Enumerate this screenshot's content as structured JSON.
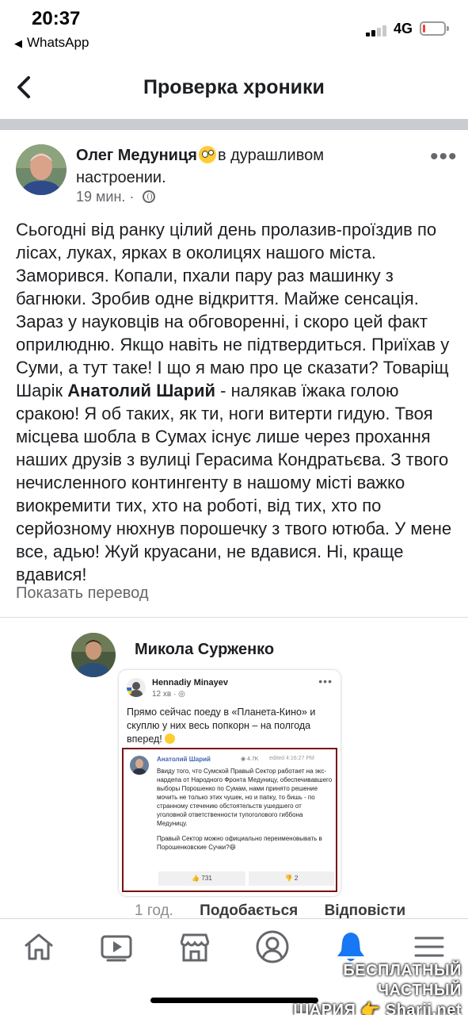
{
  "status_bar": {
    "time": "20:37",
    "back_app": "WhatsApp",
    "network": "4G",
    "battery_level": 0.1
  },
  "header": {
    "title": "Проверка хроники"
  },
  "post": {
    "author": "Олег Медуниця",
    "feeling": "в дурашливом настроении.",
    "time": "19 мин.",
    "text_before": "Сьогодні від ранку цілий день пролазив-проїздив по лісах, луках, ярках в околицях нашого міста. Заморився. Копали, пхали пару раз машинку з багнюки. Зробив одне відкриття. Майже сенсація. Зараз у науковців на обговоренні, і скоро цей факт оприлюдню. Якщо навіть не підтвердиться. Приїхав у Суми, а тут таке! І що я маю про це сказати? Товаріщ Шарік ",
    "text_bold": "Анатолий Шарий",
    "text_after": " - налякав їжака голою сракою! Я об таких, як ти, ноги витерти гидую. Твоя місцева шобла в Сумах існує лише через прохання наших друзів з вулиці Герасима Кондратьєва. З твого нечисленного контингенту в нашому місті важко виокремити тих, хто на роботі, від тих, хто по серйозному нюхнув порошечку з твого ютюба. У мене все, адью! Жуй круасани, не вдавися. Ні, краще вдавися!",
    "translate_link": "Показать перевод"
  },
  "comment": {
    "author": "Микола Сурженко",
    "time_ago": "1 год.",
    "like_label": "Подобається",
    "reply_label": "Відповісти",
    "screenshot": {
      "author": "Hennadiy Minayev",
      "time": "12 хв",
      "text": "Прямо сейчас поеду в «Планета-Кино» и скуплю у них весь попкорн – на полгода вперед!",
      "inner": {
        "author": "Анатолий Шарий",
        "views": "4.7K",
        "edited": "edited 4:16:27 PM",
        "paragraph1": "Ввиду того, что Сумской Правый Сектор работает на экс-нардепа от Народного Фронта Медуницу, обеспечивавшего выборы Порошенко по Сумам, нами принято решение мочить не только этих чушек, но и папку, то бишь - по странному стечению обстоятельств ушедшего от уголовной ответственности тупоголового гиббона Медуницу.",
        "paragraph2": "Правый Сектор можно официально переименовывать в Порошенковские Сучки?",
        "likes": "731",
        "dislikes": "2"
      }
    }
  },
  "tabbar": {
    "icons": [
      "home-icon",
      "video-icon",
      "marketplace-icon",
      "profile-icon",
      "notifications-icon",
      "menu-icon"
    ],
    "active": "notifications-icon",
    "active_color": "#1877f2"
  },
  "watermark": {
    "line1": "БЕСПЛАТНЫЙ ЧАСТНЫЙ",
    "line2": "ШАРИЯ 👉 Sharij.net"
  }
}
